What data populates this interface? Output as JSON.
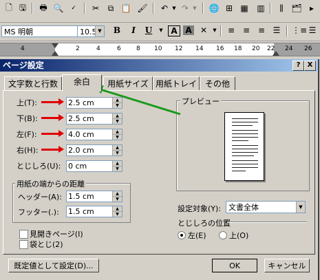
{
  "toolbar1": {
    "icons": [
      "new-doc-icon",
      "save-icon",
      "print-icon",
      "print-preview-icon",
      "spellcheck-icon",
      "cut-icon",
      "copy-icon",
      "paste-icon",
      "format-painter-icon",
      "undo-icon",
      "redo-icon",
      "hyperlink-icon",
      "table-icon",
      "insert-excel-icon",
      "columns-icon",
      "drawing-icon",
      "more-icon"
    ]
  },
  "toolbar2": {
    "font_name": "MS 明朝",
    "font_size": "10.5",
    "bold": "B",
    "italic": "I",
    "underline": "U",
    "char_border": "A",
    "char_shading": "A"
  },
  "ruler": {
    "left_num": "4",
    "numbers": [
      "2",
      "4",
      "6",
      "8",
      "10",
      "12",
      "14",
      "16",
      "18",
      "20",
      "22",
      "24",
      "26"
    ]
  },
  "dialog": {
    "title": "ページ設定",
    "help": "?",
    "close": "X",
    "tabs": [
      "文字数と行数",
      "余白",
      "用紙サイズ",
      "用紙トレイ",
      "その他"
    ],
    "active_tab": "余白",
    "margins": {
      "top_label": "上(T):",
      "top_value": "2.5 cm",
      "bottom_label": "下(B):",
      "bottom_value": "2.5 cm",
      "left_label": "左(F):",
      "left_value": "4.0 cm",
      "right_label": "右(H):",
      "right_value": "2.0 cm",
      "gutter_label": "とじしろ(U):",
      "gutter_value": "0 cm"
    },
    "edge_group": {
      "title": "用紙の端からの距離",
      "header_label": "ヘッダー(A):",
      "header_value": "1.5 cm",
      "footer_label": "フッター(.):",
      "footer_value": "1.5 cm"
    },
    "mirror_label": "見開きページ(I)",
    "bind_label": "袋とじ(2)",
    "preview_title": "プレビュー",
    "apply_label": "設定対象(Y):",
    "apply_value": "文書全体",
    "gutter_pos_title": "とじしろの位置",
    "gutter_left": "左(E)",
    "gutter_top": "上(O)",
    "default_button": "既定値として設定(D)...",
    "ok_button": "OK",
    "cancel_button": "キャンセル"
  },
  "colors": {
    "annotation_red": "#e00000",
    "annotation_green": "#1a9a1a",
    "title_blue": "#0a246a"
  }
}
